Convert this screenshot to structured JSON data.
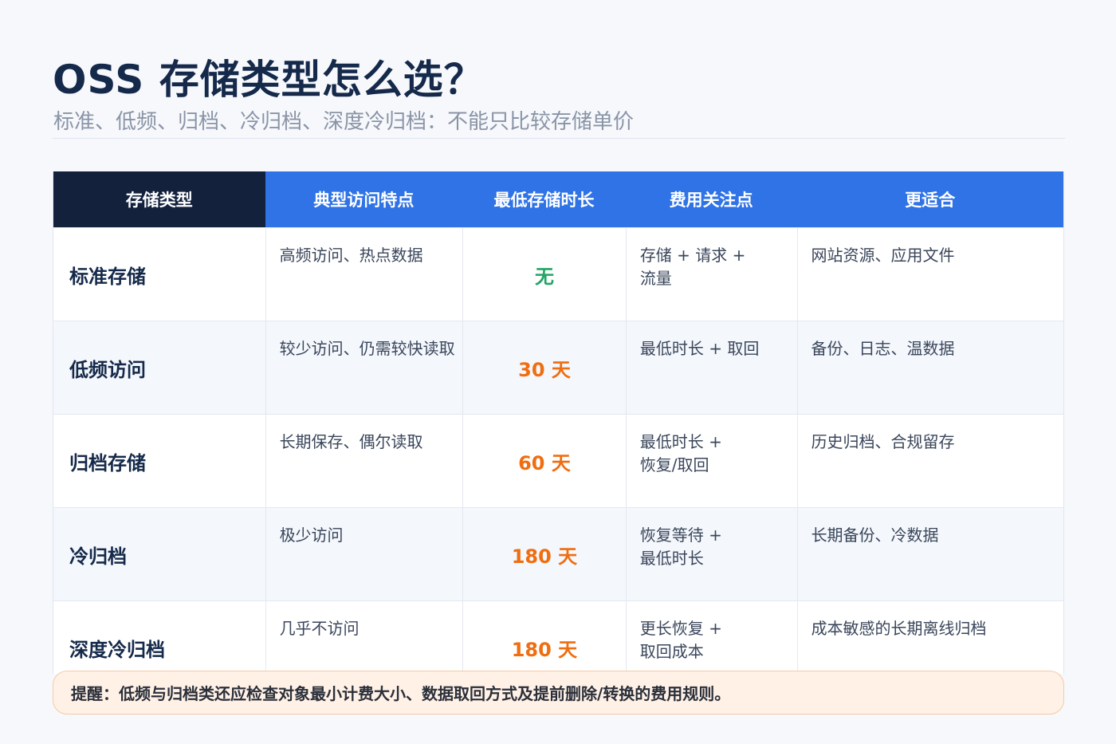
{
  "title": "OSS 存储类型怎么选？",
  "subtitle": "标准、低频、归档、冷归档、深度冷归档：不能只比较存储单价",
  "table": {
    "headers": [
      "存储类型",
      "典型访问特点",
      "最低存储时长",
      "费用关注点",
      "更适合"
    ],
    "rows": [
      {
        "type": "标准存储",
        "access": "高频访问、热点数据",
        "min_duration": "无",
        "cost": "存储 + 请求 + 流量",
        "fit": "网站资源、应用文件"
      },
      {
        "type": "低频访问",
        "access": "较少访问、仍需较快读取",
        "min_duration": "30 天",
        "cost": "最低时长 + 取回",
        "fit": "备份、日志、温数据"
      },
      {
        "type": "归档存储",
        "access": "长期保存、偶尔读取",
        "min_duration": "60 天",
        "cost": "最低时长 + 恢复/取回",
        "fit": "历史归档、合规留存"
      },
      {
        "type": "冷归档",
        "access": "极少访问",
        "min_duration": "180 天",
        "cost": "恢复等待 + 最低时长",
        "fit": "长期备份、冷数据"
      },
      {
        "type": "深度冷归档",
        "access": "几乎不访问",
        "min_duration": "180 天",
        "cost": "更长恢复 + 取回成本",
        "fit": "成本敏感的长期离线归档"
      }
    ]
  },
  "colors": {
    "header_first": "#13213d",
    "header_blue": "#2f73e6",
    "duration_none": "#22a565",
    "duration": "#f06d10",
    "note_bg": "#fff1e6"
  },
  "note": "提醒：低频与归档类还应检查对象最小计费大小、数据取回方式及提前删除/转换的费用规则。"
}
